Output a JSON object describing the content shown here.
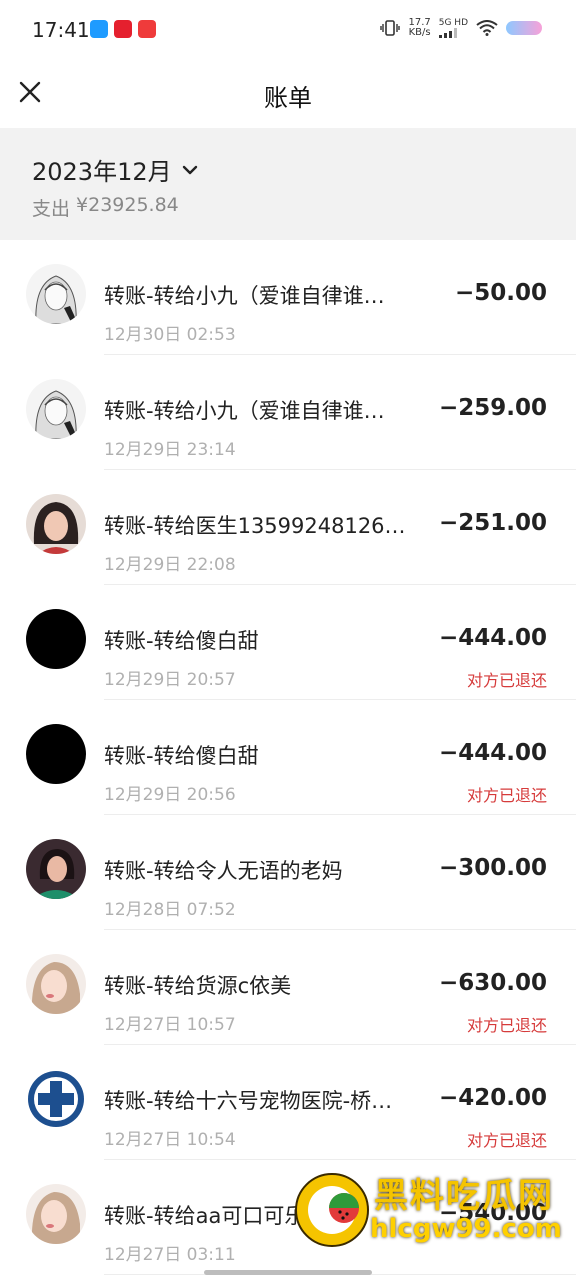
{
  "status_bar": {
    "time": "17:41",
    "speed_value": "17.7",
    "speed_unit": "KB/s",
    "network": "5G HD"
  },
  "header": {
    "title": "账单"
  },
  "summary": {
    "month": "2023年12月",
    "expense_label": "支出",
    "expense_value": "¥23925.84"
  },
  "transactions": [
    {
      "desc": "转账-转给小九（爱谁自律谁…",
      "time": "12月30日 02:53",
      "amount": "−50.00",
      "note": "",
      "avatar": "anime-girl"
    },
    {
      "desc": "转账-转给小九（爱谁自律谁…",
      "time": "12月29日 23:14",
      "amount": "−259.00",
      "note": "",
      "avatar": "anime-girl"
    },
    {
      "desc": "转账-转给医生13599248126…",
      "time": "12月29日 22:08",
      "amount": "−251.00",
      "note": "",
      "avatar": "woman-portrait"
    },
    {
      "desc": "转账-转给傻白甜",
      "time": "12月29日 20:57",
      "amount": "−444.00",
      "note": "对方已退还",
      "avatar": "black-circle"
    },
    {
      "desc": "转账-转给傻白甜",
      "time": "12月29日 20:56",
      "amount": "−444.00",
      "note": "对方已退还",
      "avatar": "black-circle"
    },
    {
      "desc": "转账-转给令人无语的老妈",
      "time": "12月28日 07:52",
      "amount": "−300.00",
      "note": "",
      "avatar": "woman-dark"
    },
    {
      "desc": "转账-转给货源c依美",
      "time": "12月27日 10:57",
      "amount": "−630.00",
      "note": "对方已退还",
      "avatar": "woman-light"
    },
    {
      "desc": "转账-转给十六号宠物医院-桥…",
      "time": "12月27日 10:54",
      "amount": "−420.00",
      "note": "对方已退还",
      "avatar": "medical-cross"
    },
    {
      "desc": "转账-转给aa可口可乐（不…",
      "time": "12月27日 03:11",
      "amount": "−540.00",
      "note": "",
      "avatar": "woman-light"
    }
  ],
  "watermark": {
    "text": "黑料吃瓜网",
    "url": "hlcgw99.com"
  }
}
